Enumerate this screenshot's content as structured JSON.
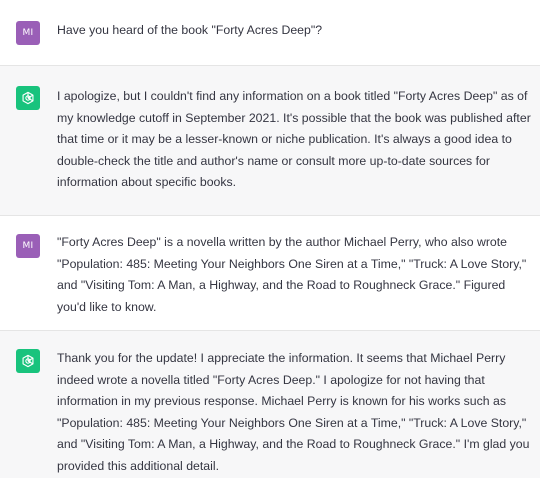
{
  "conversation": {
    "messages": [
      {
        "role": "user",
        "avatar_initials": "MI",
        "text": "Have you heard of the book \"Forty Acres Deep\"?"
      },
      {
        "role": "assistant",
        "avatar_icon": "chatgpt-logo-icon",
        "text": "I apologize, but I couldn't find any information on a book titled \"Forty Acres Deep\" as of my knowledge cutoff in September 2021. It's possible that the book was published after that time or it may be a lesser-known or niche publication. It's always a good idea to double-check the title and author's name or consult more up-to-date sources for information about specific books."
      },
      {
        "role": "user",
        "avatar_initials": "MI",
        "text": "\"Forty Acres Deep\" is a novella written by the author Michael Perry, who also wrote \"Population: 485: Meeting Your Neighbors One Siren at a Time,\" \"Truck: A Love Story,\" and \"Visiting Tom: A Man, a Highway, and the Road to Roughneck Grace.\" Figured you'd like to know."
      },
      {
        "role": "assistant",
        "avatar_icon": "chatgpt-logo-icon",
        "text": "Thank you for the update! I appreciate the information. It seems that Michael Perry indeed wrote a novella titled \"Forty Acres Deep.\" I apologize for not having that information in my previous response. Michael Perry is known for his works such as \"Population: 485: Meeting Your Neighbors One Siren at a Time,\" \"Truck: A Love Story,\" and \"Visiting Tom: A Man, a Highway, and the Road to Roughneck Grace.\" I'm glad you provided this additional detail."
      }
    ]
  },
  "colors": {
    "user_avatar": "#9a5fb7",
    "assistant_avatar": "#19c37d",
    "assistant_bg": "#f7f7f8",
    "text": "#343541"
  }
}
